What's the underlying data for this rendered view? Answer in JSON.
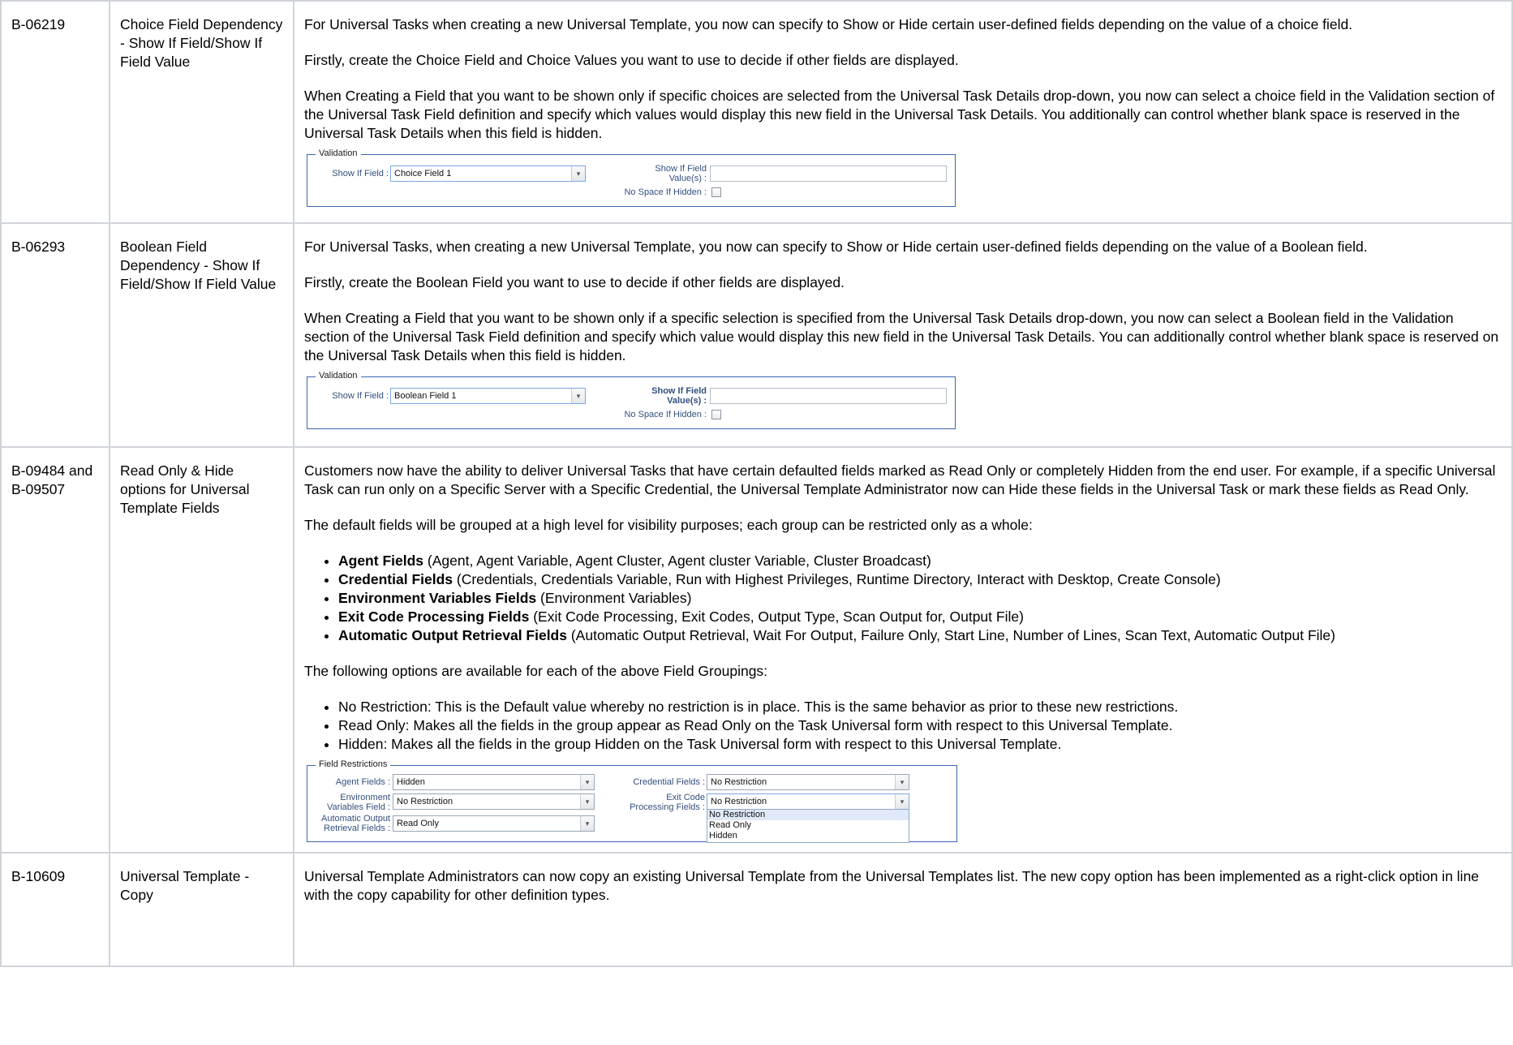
{
  "rows": [
    {
      "id": "B-06219",
      "title": "Choice Field Dependency - Show If Field/Show If Field Value",
      "paragraphs": [
        "For Universal Tasks when creating a new Universal Template, you now can specify to Show or Hide certain user-defined fields depending on the value of a choice field.",
        "Firstly, create the Choice Field and Choice Values you want to use to decide if other fields are displayed.",
        "When Creating a Field that you want to be shown only if specific choices are selected from the Universal Task Details drop-down, you now can select a choice field in the Validation section of the Universal Task Field definition and specify which values would display this new field in the Universal Task Details. You additionally can control whether blank space is reserved in the Universal Task Details when this field is hidden."
      ],
      "form": {
        "legend": "Validation",
        "show_if_field_label": "Show If Field :",
        "show_if_field_value": "Choice Field 1",
        "show_if_value_label_1": "Show If Field",
        "show_if_value_label_2": "Value(s) :",
        "no_space_label": "No Space If Hidden :"
      }
    },
    {
      "id": "B-06293",
      "title": "Boolean Field Dependency - Show If Field/Show If Field Value",
      "paragraphs": [
        "For Universal Tasks, when creating a new Universal Template, you now can specify to Show or Hide certain user-defined fields depending on the value of a Boolean field.",
        "Firstly, create the Boolean Field you want to use to decide if other fields are displayed.",
        "When Creating a Field that you want to be shown only if a specific selection is specified from the Universal Task Details drop-down, you now can select a Boolean field in the Validation section of the Universal Task Field definition and specify which value would display this new field in the Universal Task Details. You can additionally control whether blank space is reserved on the Universal Task Details when this field is hidden."
      ],
      "form": {
        "legend": "Validation",
        "show_if_field_label": "Show If Field :",
        "show_if_field_value": "Boolean Field 1",
        "show_if_value_label_1": "Show If Field",
        "show_if_value_label_2": "Value(s) :",
        "no_space_label": "No Space If Hidden :"
      }
    },
    {
      "id": "B-09484 and B-09507",
      "title": "Read Only & Hide options for Universal Template Fields",
      "para1": "Customers now have the ability to deliver Universal Tasks that have certain defaulted fields marked as Read Only or completely Hidden from the end user. For example, if a specific Universal Task can run only on a Specific Server with a Specific Credential, the Universal Template Administrator now can Hide these fields in the Universal Task or mark these fields as Read Only.",
      "para2": "The default fields will be grouped at a high level for visibility purposes; each group can be restricted only as a whole:",
      "groups": [
        {
          "name": "Agent Fields",
          "desc": " (Agent, Agent Variable, Agent Cluster, Agent cluster Variable, Cluster Broadcast)"
        },
        {
          "name": "Credential Fields",
          "desc": " (Credentials, Credentials Variable, Run with Highest Privileges, Runtime Directory, Interact with Desktop, Create Console)"
        },
        {
          "name": "Environment Variables Fields",
          "desc": " (Environment Variables)"
        },
        {
          "name": "Exit Code Processing Fields",
          "desc": " (Exit Code Processing, Exit Codes, Output Type, Scan Output for, Output File)"
        },
        {
          "name": "Automatic Output Retrieval Fields",
          "desc": " (Automatic Output Retrieval, Wait For Output, Failure Only, Start Line, Number of Lines, Scan Text, Automatic Output File)"
        }
      ],
      "para3": "The following options are available for each of the above Field Groupings:",
      "options": [
        "No Restriction: This is the Default value whereby no restriction is in place. This is the same behavior as prior to these new restrictions.",
        "Read Only: Makes all the fields in the group appear as Read Only on the Task Universal form with respect to this Universal Template.",
        "Hidden: Makes all the fields in the group Hidden on the Task Universal form with respect to this Universal Template."
      ],
      "form": {
        "legend": "Field Restrictions",
        "agent_label": "Agent Fields :",
        "agent_value": "Hidden",
        "env_label_1": "Environment",
        "env_label_2": "Variables Field :",
        "env_value": "No Restriction",
        "auto_label_1": "Automatic Output",
        "auto_label_2": "Retrieval Fields :",
        "auto_value": "Read Only",
        "cred_label": "Credential Fields :",
        "cred_value": "No Restriction",
        "exit_label_1": "Exit Code",
        "exit_label_2": "Processing Fields :",
        "exit_value": "No Restriction",
        "dropdown_options": [
          "No Restriction",
          "Read Only",
          "Hidden"
        ]
      }
    },
    {
      "id": "B-10609",
      "title": "Universal Template - Copy",
      "paragraphs": [
        "Universal Template Administrators can now copy an existing Universal Template from the Universal Templates list. The new copy option has been implemented as a right-click option in line with the copy capability for other definition types."
      ]
    }
  ]
}
